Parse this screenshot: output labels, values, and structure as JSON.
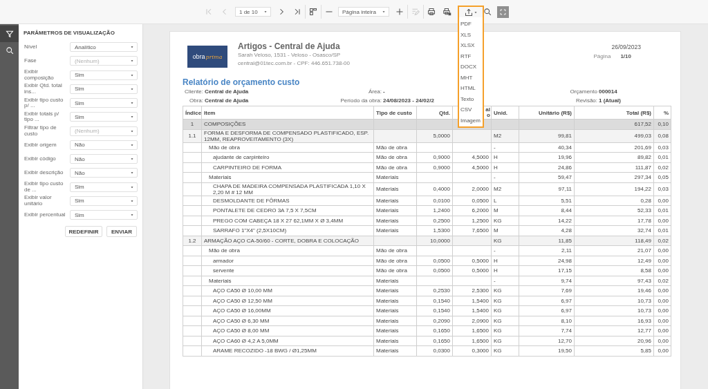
{
  "toolbar": {
    "first_page": {
      "disabled": true
    },
    "previous_page": {
      "disabled": true
    },
    "page_select": {
      "value": "1 de 10"
    },
    "next_page": {
      "disabled": false
    },
    "last_page": {
      "disabled": false
    },
    "zoom_select": {
      "value": "Página inteira"
    },
    "edit": {
      "disabled": true
    },
    "export": {
      "expanded": true,
      "options": [
        "PDF",
        "XLS",
        "XLSX",
        "RTF",
        "DOCX",
        "MHT",
        "HTML",
        "Texto",
        "CSV",
        "Imagem"
      ]
    }
  },
  "rail": {
    "items": [
      {
        "selected": true
      },
      {
        "selected": false
      }
    ]
  },
  "parameters": {
    "title": "PARÂMETROS DE VISUALIZAÇÃO",
    "fields": [
      {
        "label": "Nível",
        "value": "Analítico"
      },
      {
        "label": "Fase",
        "placeholder": "(Nenhum)"
      },
      {
        "label": "Exibir composição",
        "value": "Sim"
      },
      {
        "label": "Exibir Qtd. total ins...",
        "value": "Sim"
      },
      {
        "label": "Exibir tipo custo p/ ...",
        "value": "Sim"
      },
      {
        "label": "Exibir totais p/ tipo ...",
        "value": "Sim"
      },
      {
        "label": "Filtrar tipo de custo",
        "placeholder": "(Nenhum)"
      },
      {
        "label": "Exibir origem",
        "value": "Não"
      },
      {
        "label": "Exibir código",
        "value": "Não"
      },
      {
        "label": "Exibir descrição",
        "value": "Não"
      },
      {
        "label": "Exibir tipo custo de ...",
        "value": "Sim"
      },
      {
        "label": "Exibir valor unitário",
        "value": "Sim"
      },
      {
        "label": "Exibir percentual",
        "value": "Sim"
      }
    ],
    "buttons": [
      "REDEFINIR",
      "ENVIAR"
    ]
  },
  "report": {
    "logo": {
      "part_1": "obra",
      "part_2": "prima"
    },
    "company": "Artigos - Central de Ajuda",
    "address": "Sarah Veloso, 1531 - Veloso - Osasco/SP",
    "contact": "central@01tec.com.br - CPF: 446.651.738-00",
    "date": "26/09/2023",
    "page_label": "Página",
    "page_value": "1/10",
    "title": "Relatório de orçamento custo",
    "meta": [
      {
        "label": "Cliente:",
        "value": "Central de Ajuda"
      },
      {
        "label": "Área:",
        "value": "-"
      },
      {
        "label": "Orçamento",
        "value": "000014"
      },
      {
        "label": "Obra:",
        "value": "Central de Ajuda"
      },
      {
        "label": "Período da obra:",
        "value": "24/08/2023 - 24/02/2"
      },
      {
        "label": "Revisão:",
        "value": "1 (Atual)"
      }
    ],
    "table": {
      "columns": [
        "Índice",
        "Item",
        "Tipo de custo",
        "Qtd.",
        "al\no",
        "Unid.",
        "Unitário (R$)",
        "Total (R$)",
        "%"
      ],
      "rows": [
        {
          "kind": "group",
          "index": "1",
          "item": "COMPOSIÇÕES",
          "total": "617,52",
          "percent": "0,10"
        },
        {
          "kind": "composition",
          "index": "1.1",
          "item": "FORMA E DESFORMA DE COMPENSADO PLASTIFICADO, ESP. 12MM, REAPROVEITAMENTO (3X)",
          "qty": "5,0000",
          "unit": "M2",
          "unit_price": "99,81",
          "total": "499,03",
          "percent": "0,08"
        },
        {
          "kind": "category",
          "item": "Mão de obra",
          "cost_type": "Mão de obra",
          "unit": "-",
          "unit_price": "40,34",
          "total": "201,69",
          "percent": "0,03"
        },
        {
          "kind": "input",
          "item": "ajudante de carpinteiro",
          "cost_type": "Mão de obra",
          "qty": "0,9000",
          "column_5": "4,5000",
          "unit": "H",
          "unit_price": "19,96",
          "total": "89,82",
          "percent": "0,01"
        },
        {
          "kind": "input",
          "item": "CARPINTEIRO DE FORMA",
          "cost_type": "Mão de obra",
          "qty": "0,9000",
          "column_5": "4,5000",
          "unit": "H",
          "unit_price": "24,86",
          "total": "111,87",
          "percent": "0,02"
        },
        {
          "kind": "category",
          "item": "Materiais",
          "cost_type": "Materiais",
          "unit": "-",
          "unit_price": "59,47",
          "total": "297,34",
          "percent": "0,05"
        },
        {
          "kind": "input",
          "item": "CHAPA DE MADEIRA COMPENSADA PLASTIFICADA 1,10 X 2,20 M # 12 MM",
          "cost_type": "Materiais",
          "qty": "0,4000",
          "column_5": "2,0000",
          "unit": "M2",
          "unit_price": "97,11",
          "total": "194,22",
          "percent": "0,03"
        },
        {
          "kind": "input",
          "item": "DESMOLDANTE DE FÔRMAS",
          "cost_type": "Materiais",
          "qty": "0,0100",
          "column_5": "0,0500",
          "unit": "L",
          "unit_price": "5,51",
          "total": "0,28",
          "percent": "0,00"
        },
        {
          "kind": "input",
          "item": "PONTALETE DE CEDRO 3A 7,5 X 7,5CM",
          "cost_type": "Materiais",
          "qty": "1,2400",
          "column_5": "6,2000",
          "unit": "M",
          "unit_price": "8,44",
          "total": "52,33",
          "percent": "0,01"
        },
        {
          "kind": "input",
          "item": "PREGO COM CABEÇA 18 X 27 62,1MM X Ø 3,4MM",
          "cost_type": "Materiais",
          "qty": "0,2500",
          "column_5": "1,2500",
          "unit": "KG",
          "unit_price": "14,22",
          "total": "17,78",
          "percent": "0,00"
        },
        {
          "kind": "input",
          "item": "SARRAFO 1\"X4\" (2,5X10CM)",
          "cost_type": "Materiais",
          "qty": "1,5300",
          "column_5": "7,6500",
          "unit": "M",
          "unit_price": "4,28",
          "total": "32,74",
          "percent": "0,01"
        },
        {
          "kind": "composition",
          "index": "1.2",
          "item": "ARMAÇÃO AÇO CA-50/60 - CORTE, DOBRA E COLOCAÇÃO",
          "qty": "10,0000",
          "unit": "KG",
          "unit_price": "11,85",
          "total": "118,49",
          "percent": "0,02"
        },
        {
          "kind": "category",
          "item": "Mão de obra",
          "cost_type": "Mão de obra",
          "unit": "-",
          "unit_price": "2,11",
          "total": "21,07",
          "percent": "0,00"
        },
        {
          "kind": "input",
          "item": "armador",
          "cost_type": "Mão de obra",
          "qty": "0,0500",
          "column_5": "0,5000",
          "unit": "H",
          "unit_price": "24,98",
          "total": "12,49",
          "percent": "0,00"
        },
        {
          "kind": "input",
          "item": "servente",
          "cost_type": "Mão de obra",
          "qty": "0,0500",
          "column_5": "0,5000",
          "unit": "H",
          "unit_price": "17,15",
          "total": "8,58",
          "percent": "0,00"
        },
        {
          "kind": "category",
          "item": "Materiais",
          "cost_type": "Materiais",
          "unit": "-",
          "unit_price": "9,74",
          "total": "97,43",
          "percent": "0,02"
        },
        {
          "kind": "input",
          "item": "AÇO CA50 Ø 10,00 MM",
          "cost_type": "Materiais",
          "qty": "0,2530",
          "column_5": "2,5300",
          "unit": "KG",
          "unit_price": "7,69",
          "total": "19,46",
          "percent": "0,00"
        },
        {
          "kind": "input",
          "item": "AÇO CA50 Ø 12,50 MM",
          "cost_type": "Materiais",
          "qty": "0,1540",
          "column_5": "1,5400",
          "unit": "KG",
          "unit_price": "6,97",
          "total": "10,73",
          "percent": "0,00"
        },
        {
          "kind": "input",
          "item": "AÇO CA50 Ø 16,00MM",
          "cost_type": "Materiais",
          "qty": "0,1540",
          "column_5": "1,5400",
          "unit": "KG",
          "unit_price": "6,97",
          "total": "10,73",
          "percent": "0,00"
        },
        {
          "kind": "input",
          "item": "AÇO CA50 Ø 6,30 MM",
          "cost_type": "Materiais",
          "qty": "0,2090",
          "column_5": "2,0900",
          "unit": "KG",
          "unit_price": "8,10",
          "total": "16,93",
          "percent": "0,00"
        },
        {
          "kind": "input",
          "item": "AÇO CA50 Ø 8,00 MM",
          "cost_type": "Materiais",
          "qty": "0,1650",
          "column_5": "1,6500",
          "unit": "KG",
          "unit_price": "7,74",
          "total": "12,77",
          "percent": "0,00"
        },
        {
          "kind": "input",
          "item": "AÇO CA60 Ø 4,2 A 5,0MM",
          "cost_type": "Materiais",
          "qty": "0,1650",
          "column_5": "1,6500",
          "unit": "KG",
          "unit_price": "12,70",
          "total": "20,96",
          "percent": "0,00"
        },
        {
          "kind": "input",
          "item": "ARAME RECOZIDO -18 BWG / Ø1,25MM",
          "cost_type": "Materiais",
          "qty": "0,0300",
          "column_5": "0,3000",
          "unit": "KG",
          "unit_price": "19,50",
          "total": "5,85",
          "percent": "0,00"
        }
      ]
    }
  }
}
